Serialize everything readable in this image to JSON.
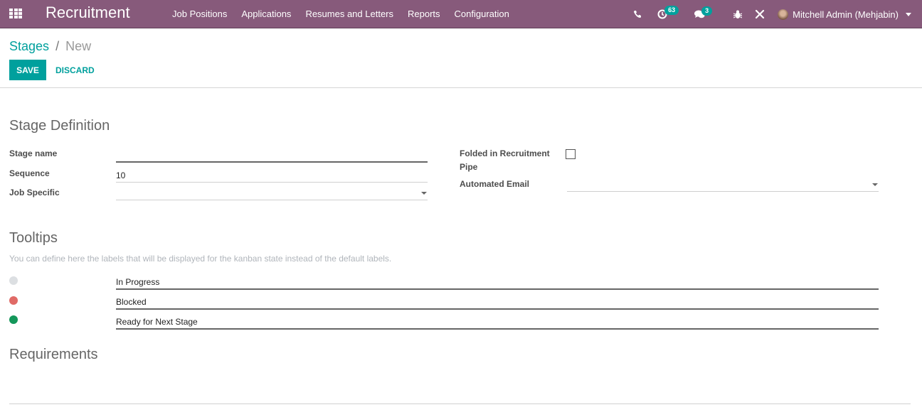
{
  "navbar": {
    "app_name": "Recruitment",
    "menu": [
      "Job Positions",
      "Applications",
      "Resumes and Letters",
      "Reports",
      "Configuration"
    ],
    "systray": {
      "phone_icon": "phone-icon",
      "activity_count": "63",
      "messages_count": "3",
      "debug_icon": "bug-icon",
      "tools_icon": "tools-icon",
      "user_name": "Mitchell Admin (Mehjabin)"
    }
  },
  "breadcrumb": {
    "parent": "Stages",
    "separator": "/",
    "current": "New"
  },
  "buttons": {
    "save": "SAVE",
    "discard": "DISCARD"
  },
  "form": {
    "stage_definition": {
      "title": "Stage Definition",
      "stage_name_label": "Stage name",
      "stage_name_value": "",
      "sequence_label": "Sequence",
      "sequence_value": "10",
      "job_specific_label": "Job Specific",
      "job_specific_value": "",
      "folded_label": "Folded in Recruitment Pipe",
      "folded_checked": false,
      "automated_email_label": "Automated Email",
      "automated_email_value": ""
    },
    "tooltips": {
      "title": "Tooltips",
      "hint": "You can define here the labels that will be displayed for the kanban state instead of the default labels.",
      "states": [
        {
          "color": "#dcdfe2",
          "label": "In Progress"
        },
        {
          "color": "#e06a66",
          "label": "Blocked"
        },
        {
          "color": "#14975a",
          "label": "Ready for Next Stage"
        }
      ]
    },
    "requirements": {
      "title": "Requirements"
    }
  },
  "colors": {
    "navbar": "#875a7b",
    "primary": "#00a09d"
  }
}
